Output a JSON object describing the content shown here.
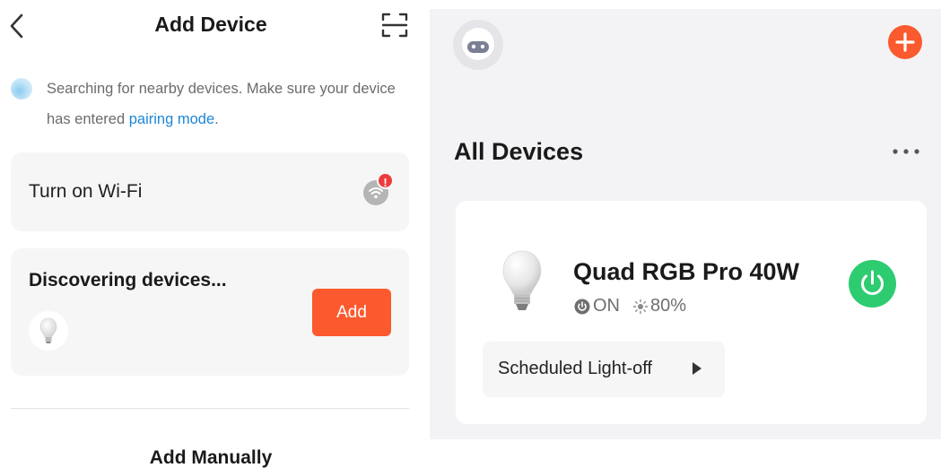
{
  "add_device": {
    "title": "Add Device",
    "search_text": "Searching for nearby devices. Make sure your device has entered ",
    "pairing_link": "pairing mode",
    "search_text_end": ".",
    "wifi_label": "Turn on Wi-Fi",
    "wifi_alert": "!",
    "discover_title": "Discovering devices...",
    "add_label": "Add",
    "add_manually": "Add Manually"
  },
  "home": {
    "section_title": "All Devices",
    "device": {
      "name": "Quad RGB Pro 40W",
      "power_state": "ON",
      "brightness": "80%",
      "schedule_label": "Scheduled Light-off"
    }
  },
  "colors": {
    "accent_orange": "#fc5a2e",
    "power_green": "#2ecc71",
    "link_blue": "#1e86d6",
    "alert_red": "#ee3b3b"
  },
  "icons": [
    "back-chevron-icon",
    "scan-icon",
    "wifi-icon",
    "bulb-icon",
    "robot-avatar-icon",
    "plus-icon",
    "more-dots-icon",
    "power-icon",
    "brightness-icon",
    "play-arrow-icon"
  ]
}
